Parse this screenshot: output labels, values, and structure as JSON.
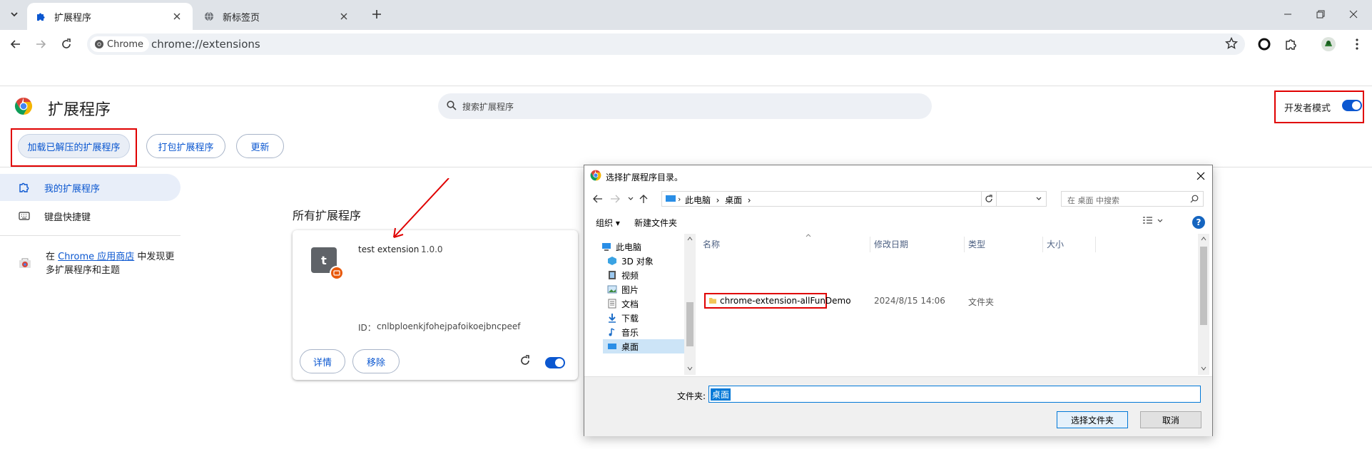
{
  "browser": {
    "tabs": [
      {
        "title": "扩展程序",
        "icon": "puzzle-icon",
        "active": true
      },
      {
        "title": "新标签页",
        "icon": "globe-icon",
        "active": false
      }
    ],
    "omnibox": {
      "chip_label": "Chrome",
      "url": "chrome://extensions"
    }
  },
  "page": {
    "title": "扩展程序",
    "search_placeholder": "搜索扩展程序",
    "dev_mode_label": "开发者模式",
    "dev_mode_on": true,
    "buttons": {
      "load_unpacked": "加载已解压的扩展程序",
      "pack": "打包扩展程序",
      "update": "更新"
    },
    "nav": {
      "my_extensions": "我的扩展程序",
      "shortcuts": "键盘快捷键",
      "store_prefix": "在 ",
      "store_link": "Chrome 应用商店",
      "store_suffix": " 中发现更多扩展程序和主题"
    },
    "section_title": "所有扩展程序",
    "extension": {
      "icon_letter": "t",
      "name": "test extension",
      "version": "1.0.0",
      "id_label": "ID：",
      "id": "cnlbploenkjfohejpafoikoejbncpeef",
      "details_label": "详情",
      "remove_label": "移除",
      "enabled": true
    }
  },
  "dialog": {
    "title": "选择扩展程序目录。",
    "breadcrumb": [
      "此电脑",
      "桌面"
    ],
    "search_placeholder": "在 桌面 中搜索",
    "commands": {
      "organize": "组织 ▾",
      "new_folder": "新建文件夹"
    },
    "tree": [
      "此电脑",
      "3D 对象",
      "视频",
      "图片",
      "文档",
      "下载",
      "音乐",
      "桌面"
    ],
    "columns": {
      "name": "名称",
      "modified": "修改日期",
      "type": "类型",
      "size": "大小"
    },
    "row": {
      "name": "chrome-extension-allFunDemo",
      "modified": "2024/8/15 14:06",
      "type": "文件夹"
    },
    "folder_label": "文件夹:",
    "folder_value": "桌面",
    "select_button": "选择文件夹",
    "cancel_button": "取消"
  },
  "colors": {
    "accent": "#0b57d0",
    "highlight": "#e00000",
    "selection": "#0078d7"
  }
}
